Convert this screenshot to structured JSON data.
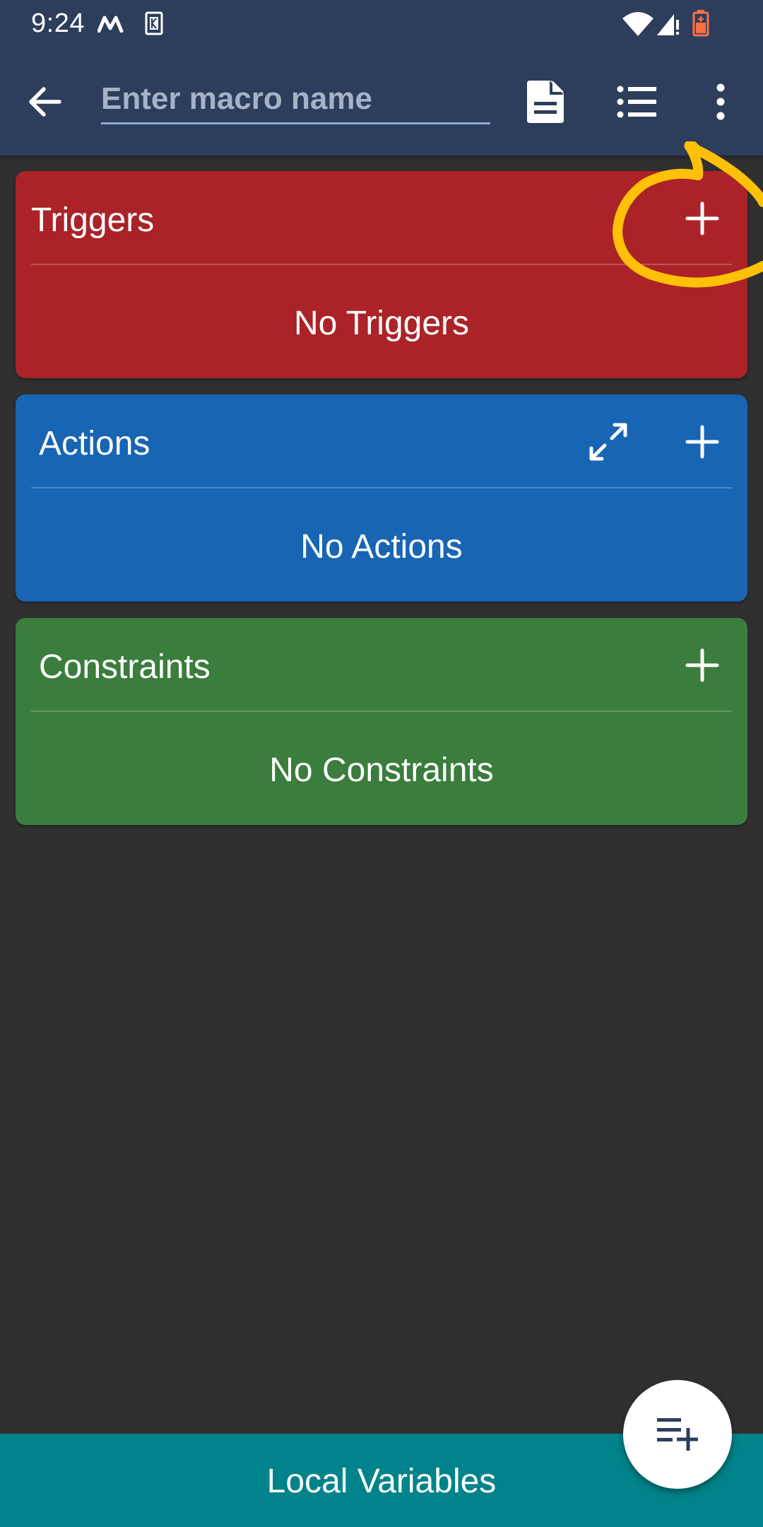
{
  "status_bar": {
    "time": "9:24",
    "icons": [
      "m-logo-icon",
      "k-notification-icon",
      "wifi-icon",
      "signal-icon",
      "battery-icon"
    ]
  },
  "toolbar": {
    "back_icon": "arrow-back-icon",
    "name_placeholder": "Enter macro name",
    "name_value": "",
    "actions": [
      "document-icon",
      "list-icon",
      "more-vert-icon"
    ]
  },
  "sections": {
    "triggers": {
      "title": "Triggers",
      "empty_text": "No Triggers",
      "color": "#ab2328"
    },
    "actions": {
      "title": "Actions",
      "empty_text": "No Actions",
      "color": "#1765b3"
    },
    "constraints": {
      "title": "Constraints",
      "empty_text": "No Constraints",
      "color": "#3a7d3c"
    }
  },
  "annotation": {
    "color": "#ffc107"
  },
  "bottom_bar": {
    "label": "Local Variables",
    "color": "#00838a"
  },
  "fab": {
    "icon": "playlist-add-icon"
  },
  "colors": {
    "toolbar": "#2c3e5c",
    "background": "#303030"
  }
}
